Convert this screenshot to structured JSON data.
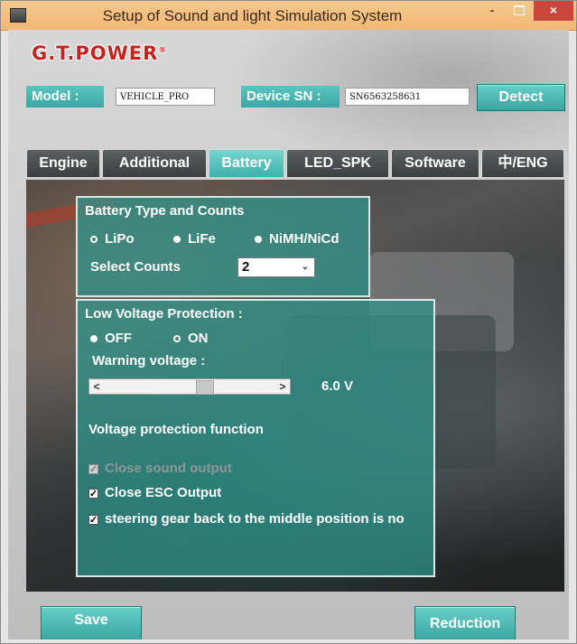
{
  "window": {
    "title": "Setup of Sound and light Simulation System",
    "minimize": "-",
    "close": "×"
  },
  "brand": {
    "logo": "G.T.POWER",
    "mark": "®"
  },
  "device": {
    "model_label": "Model :",
    "model_value": "VEHICLE_PRO",
    "sn_label": "Device SN :",
    "sn_value": "SN6563258631",
    "detect": "Detect"
  },
  "tabs": [
    "Engine",
    "Additional",
    "Battery",
    "LED_SPK",
    "Software",
    "中/ENG"
  ],
  "active_tab": "Battery",
  "battery_type": {
    "title": "Battery Type and Counts",
    "options": [
      "LiPo",
      "LiFe",
      "NiMH/NiCd"
    ],
    "selected": "LiPo",
    "count_label": "Select Counts",
    "count_value": "2"
  },
  "low_voltage": {
    "title": "Low Voltage Protection :",
    "off": "OFF",
    "on": "ON",
    "selected": "ON",
    "warning_label": "Warning voltage :",
    "voltage": "6.0 V",
    "slider_level": 0.6,
    "function_title": "Voltage protection function",
    "checks": [
      {
        "label": "Close sound output",
        "checked": true,
        "enabled": false
      },
      {
        "label": "Close ESC Output",
        "checked": true,
        "enabled": true
      },
      {
        "label": "steering gear back to the middle position is no",
        "checked": true,
        "enabled": true
      }
    ]
  },
  "buttons": {
    "save": "Save",
    "reduction": "Reduction"
  },
  "colors": {
    "accent": "#3aa7a2",
    "titlebar": "#f2b877",
    "close": "#c9463d",
    "logo": "#c8211f"
  },
  "icons": {
    "app": "app-icon",
    "select_arrow": "chevron-down-icon",
    "scroll_left": "chevron-left-icon",
    "scroll_right": "chevron-right-icon"
  }
}
